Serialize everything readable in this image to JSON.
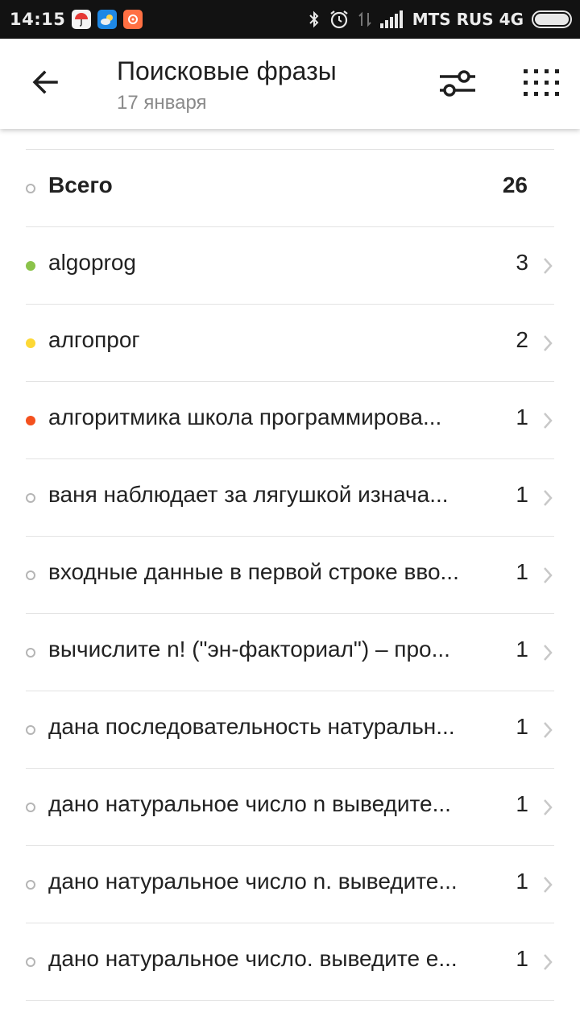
{
  "status_bar": {
    "time": "14:15",
    "carrier": "MTS RUS 4G",
    "battery_level": 1.0
  },
  "header": {
    "title": "Поисковые фразы",
    "subtitle": "17 января",
    "icons": [
      "back-arrow-icon",
      "filter-sliders-icon",
      "grid-menu-icon"
    ]
  },
  "colors": {
    "green": "#8bc34a",
    "yellow": "#fdd835",
    "red": "#f4511e",
    "grey_outline": "#b5b5b5"
  },
  "list": {
    "total": {
      "label": "Всего",
      "count": "26"
    },
    "items": [
      {
        "label": "algoprog",
        "count": "3",
        "dot": "green"
      },
      {
        "label": "алгопрог",
        "count": "2",
        "dot": "yellow"
      },
      {
        "label": "алгоритмика школа программирова...",
        "count": "1",
        "dot": "red"
      },
      {
        "label": "ваня наблюдает за лягушкой изнача...",
        "count": "1",
        "dot": "outline"
      },
      {
        "label": "входные данные в первой строке вво...",
        "count": "1",
        "dot": "outline"
      },
      {
        "label": "вычислите n! (\"эн-факториал\") – про...",
        "count": "1",
        "dot": "outline"
      },
      {
        "label": "дана последовательность натуральн...",
        "count": "1",
        "dot": "outline"
      },
      {
        "label": "дано натуральное число n выведите...",
        "count": "1",
        "dot": "outline"
      },
      {
        "label": "дано натуральное число n. выведите...",
        "count": "1",
        "dot": "outline"
      },
      {
        "label": "дано натуральное число. выведите е...",
        "count": "1",
        "dot": "outline"
      }
    ]
  }
}
